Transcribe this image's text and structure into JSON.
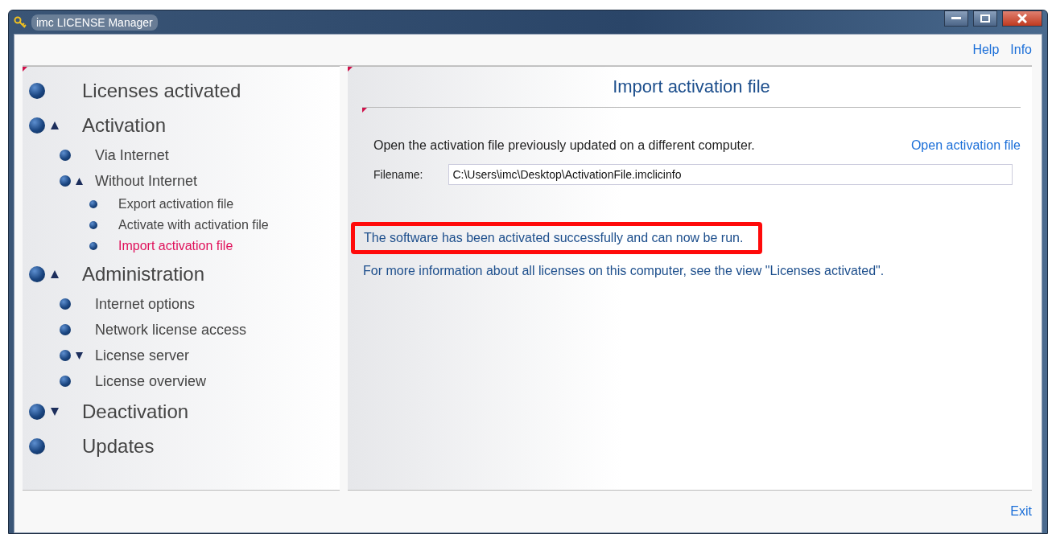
{
  "window": {
    "title": "imc LICENSE Manager"
  },
  "header_links": [
    "Help",
    "Info"
  ],
  "sidebar": {
    "items": [
      {
        "label": "Licenses activated",
        "selected": false
      },
      {
        "label": "Activation",
        "selected": false,
        "expanded": true,
        "children": [
          {
            "label": "Via Internet",
            "selected": false
          },
          {
            "label": "Without Internet",
            "selected": false,
            "expanded": true,
            "children": [
              {
                "label": "Export activation file",
                "selected": false
              },
              {
                "label": "Activate with activation file",
                "selected": false
              },
              {
                "label": "Import activation file",
                "selected": true
              }
            ]
          }
        ]
      },
      {
        "label": "Administration",
        "selected": false,
        "expanded": true,
        "children": [
          {
            "label": "Internet options",
            "selected": false
          },
          {
            "label": "Network license access",
            "selected": false
          },
          {
            "label": "License server",
            "selected": false,
            "expanded": false
          },
          {
            "label": "License overview",
            "selected": false
          }
        ]
      },
      {
        "label": "Deactivation",
        "selected": false,
        "expanded": false
      },
      {
        "label": "Updates",
        "selected": false
      }
    ]
  },
  "content": {
    "title": "Import activation file",
    "description": "Open the activation file previously updated on a different computer.",
    "open_link": "Open activation file",
    "filename_label": "Filename:",
    "filename_value": "C:\\Users\\imc\\Desktop\\ActivationFile.imclicinfo",
    "messages": [
      {
        "text": "The software has been activated successfully and can now be run.",
        "highlighted": true
      },
      {
        "text": "For more information about all licenses on this computer, see the view \"Licenses activated\".",
        "highlighted": false
      }
    ]
  },
  "footer": {
    "exit": "Exit"
  }
}
